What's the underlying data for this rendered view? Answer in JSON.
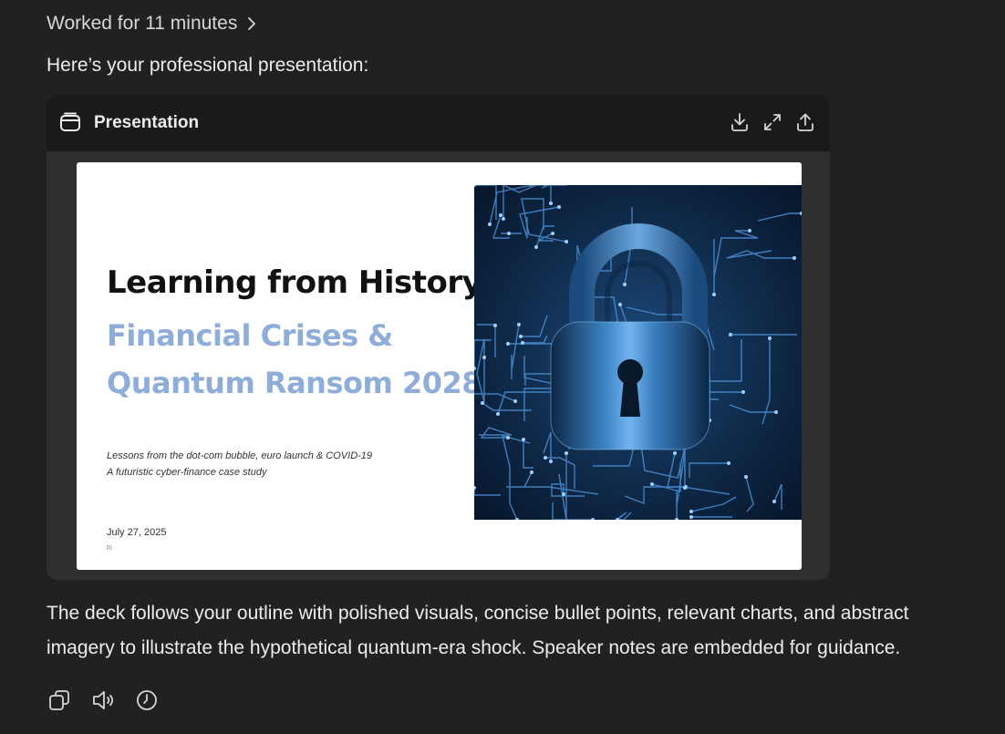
{
  "worked": {
    "label": "Worked for 11 minutes"
  },
  "intro": "Here’s your professional presentation:",
  "card": {
    "title": "Presentation",
    "icons": [
      "download-icon",
      "expand-icon",
      "share-icon"
    ]
  },
  "slide": {
    "title": "Learning from History",
    "subtitle_line1": "Financial Crises &",
    "subtitle_line2": "Quantum Ransom 2028",
    "tagline_line1": "Lessons from the dot-com bubble, euro launch & COVID-19",
    "tagline_line2": "A futuristic cyber-finance case study",
    "date": "July 27, 2025",
    "slide_number": "[1]"
  },
  "summary": "The deck follows your outline with polished visuals, concise bullet points, relevant charts, and abstract imagery to illustrate the hypothetical quantum-era shock. Speaker notes are embedded for guidance.",
  "actions": [
    "copy-icon",
    "read-aloud-icon",
    "history-icon"
  ],
  "colors": {
    "background": "#212121",
    "card": "#2f2f2f",
    "card_header": "#1a1a1a",
    "subtitle_blue": "#8fadd9",
    "circuit_blue": "#4a8fd6"
  }
}
